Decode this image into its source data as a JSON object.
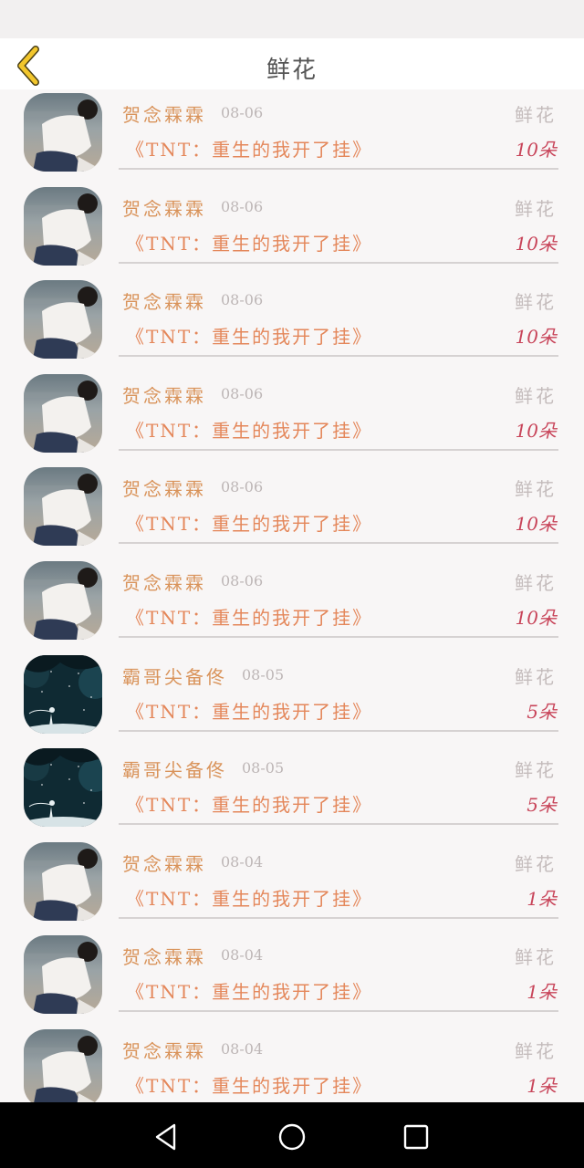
{
  "header": {
    "title": "鲜花"
  },
  "records": [
    {
      "name": "贺念霖霖",
      "date": "08-06",
      "type": "鲜花",
      "book": "《TNT：重生的我开了挂》",
      "count": "10朵",
      "avatar": "photo-avatar"
    },
    {
      "name": "贺念霖霖",
      "date": "08-06",
      "type": "鲜花",
      "book": "《TNT：重生的我开了挂》",
      "count": "10朵",
      "avatar": "photo-avatar"
    },
    {
      "name": "贺念霖霖",
      "date": "08-06",
      "type": "鲜花",
      "book": "《TNT：重生的我开了挂》",
      "count": "10朵",
      "avatar": "photo-avatar"
    },
    {
      "name": "贺念霖霖",
      "date": "08-06",
      "type": "鲜花",
      "book": "《TNT：重生的我开了挂》",
      "count": "10朵",
      "avatar": "photo-avatar"
    },
    {
      "name": "贺念霖霖",
      "date": "08-06",
      "type": "鲜花",
      "book": "《TNT：重生的我开了挂》",
      "count": "10朵",
      "avatar": "photo-avatar"
    },
    {
      "name": "贺念霖霖",
      "date": "08-06",
      "type": "鲜花",
      "book": "《TNT：重生的我开了挂》",
      "count": "10朵",
      "avatar": "photo-avatar"
    },
    {
      "name": "霸哥尖备佟",
      "date": "08-05",
      "type": "鲜花",
      "book": "《TNT：重生的我开了挂》",
      "count": "5朵",
      "avatar": "anime-avatar"
    },
    {
      "name": "霸哥尖备佟",
      "date": "08-05",
      "type": "鲜花",
      "book": "《TNT：重生的我开了挂》",
      "count": "5朵",
      "avatar": "anime-avatar"
    },
    {
      "name": "贺念霖霖",
      "date": "08-04",
      "type": "鲜花",
      "book": "《TNT：重生的我开了挂》",
      "count": "1朵",
      "avatar": "photo-avatar"
    },
    {
      "name": "贺念霖霖",
      "date": "08-04",
      "type": "鲜花",
      "book": "《TNT：重生的我开了挂》",
      "count": "1朵",
      "avatar": "photo-avatar"
    },
    {
      "name": "贺念霖霖",
      "date": "08-04",
      "type": "鲜花",
      "book": "《TNT：重生的我开了挂》",
      "count": "1朵",
      "avatar": "photo-avatar"
    }
  ],
  "icons": {
    "back": "chevron-left-icon",
    "nav_back": "triangle-back-icon",
    "nav_home": "circle-home-icon",
    "nav_recent": "square-recent-icon"
  },
  "colors": {
    "accent_yellow": "#f2c62c",
    "name_orange": "#d9935a",
    "book_orange": "#e4875a",
    "count_red": "#c8455a"
  }
}
